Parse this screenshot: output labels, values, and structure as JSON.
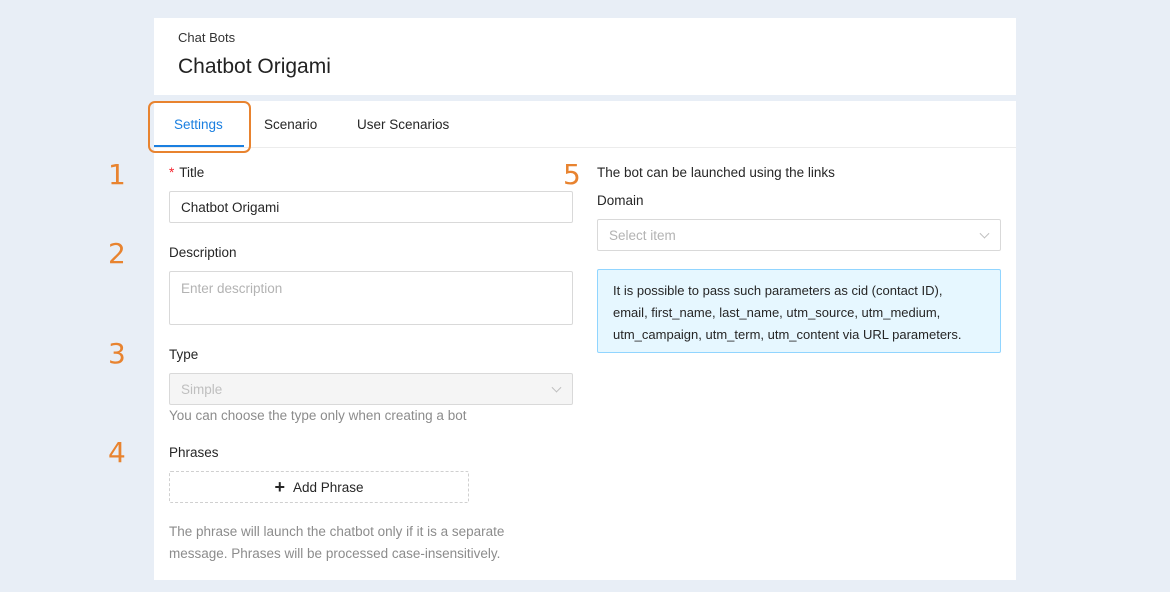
{
  "header": {
    "breadcrumb": "Chat Bots",
    "title": "Chatbot Origami"
  },
  "tabs": [
    {
      "label": "Settings",
      "active": true
    },
    {
      "label": "Scenario",
      "active": false
    },
    {
      "label": "User Scenarios",
      "active": false
    }
  ],
  "step_numbers": [
    "1",
    "2",
    "3",
    "4",
    "5"
  ],
  "form": {
    "title_required_mark": "*",
    "title_label": "Title",
    "title_value": "Chatbot Origami",
    "description_label": "Description",
    "description_placeholder": "Enter description",
    "type_label": "Type",
    "type_value": "Simple",
    "type_hint": "You can choose the type only when creating a bot",
    "phrases_label": "Phrases",
    "add_phrase_label": "Add Phrase",
    "phrases_hint_line1": "The phrase will launch the chatbot only if it is a separate",
    "phrases_hint_line2": "message. Phrases will be processed case-insensitively."
  },
  "links": {
    "heading": "The bot can be launched using the links",
    "domain_label": "Domain",
    "domain_placeholder": "Select item",
    "info_line1": "It is possible to pass such parameters as cid (contact ID),",
    "info_line2": "email, first_name, last_name, utm_source, utm_medium,",
    "info_line3": "utm_campaign, utm_term, utm_content via URL parameters."
  },
  "colors": {
    "accent": "#1a7fe0",
    "annotation": "#e8832f",
    "required": "#f5222d",
    "info_bg": "#e6f7ff",
    "info_border": "#91d5ff"
  },
  "icons": {
    "add": "plus-icon",
    "select": "chevron-down-icon"
  }
}
